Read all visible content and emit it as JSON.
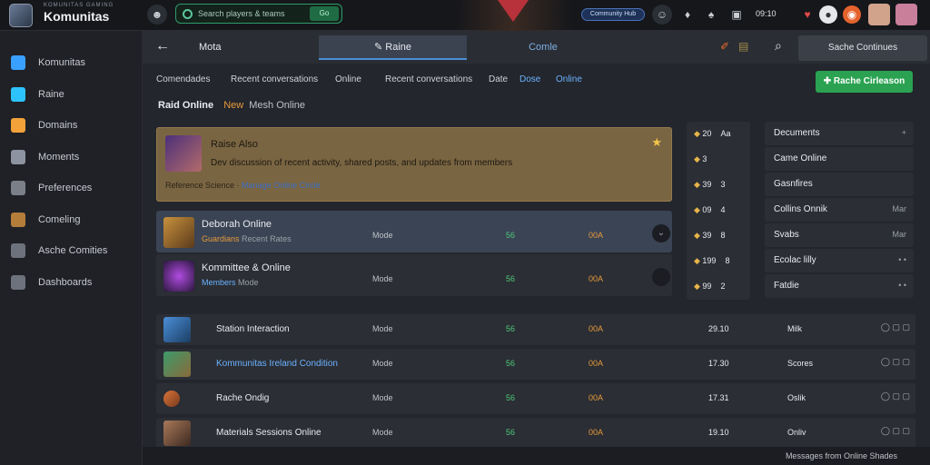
{
  "app": {
    "title": "Komunitas",
    "subtitle": "KOMUNITAS GAMING",
    "search_text": "Search players & teams",
    "search_button": "Go",
    "notice_pill": "Community Hub",
    "clock": "09:10"
  },
  "sidebar": {
    "items": [
      {
        "label": "Komunitas",
        "icon": "globe-icon",
        "color": "#3aa0ff"
      },
      {
        "label": "Raine",
        "icon": "chart-icon",
        "color": "#2ec3ff"
      },
      {
        "label": "Domains",
        "icon": "star-icon",
        "color": "#f3a23a"
      },
      {
        "label": "Moments",
        "icon": "people-icon",
        "color": "#8d93a0"
      },
      {
        "label": "Preferences",
        "icon": "briefcase-icon",
        "color": "#7a7f88"
      },
      {
        "label": "Comeling",
        "icon": "folder-icon",
        "color": "#b57d3a"
      },
      {
        "label": "Asche Comities",
        "icon": "box-icon",
        "color": "#6d727c"
      },
      {
        "label": "Dashboards",
        "icon": "chat-icon",
        "color": "#6d727c"
      }
    ]
  },
  "subheader": {
    "title": "Mota",
    "active_tab": "Raine",
    "second_tab": "Comle",
    "search_label": "Sache Continues"
  },
  "filters": {
    "items": [
      "Comendades",
      "Recent conversations",
      "Online",
      "Recent conversations",
      "Date",
      "Dose",
      "Online"
    ]
  },
  "cta_label": "Rache Cirleason",
  "subtabs": {
    "tab1": "Raid Online",
    "tab2": "Mesh Online",
    "badge": "New"
  },
  "feature": {
    "title": "Raise Also",
    "description": "Dev discussion of recent activity, shared posts, and updates from members",
    "meta": "Reference Science",
    "meta_link": "Manage Online Circle"
  },
  "grid_rows": [
    {
      "name": "Deborah Online",
      "sub": "Guardians",
      "sub2": "Recent Rates",
      "c1": "Mode",
      "c2": "56",
      "c3": "00A"
    },
    {
      "name": "Kommittee & Online",
      "sub": "Members",
      "sub2": "Mode",
      "c1": "Mode",
      "c2": "56",
      "c3": "00A"
    }
  ],
  "list_rows": [
    {
      "name": "Station Interaction",
      "c1": "Mode",
      "c2": "56",
      "c3": "00A",
      "c4": "29.10",
      "c5": "Milk"
    },
    {
      "name": "Kommunitas Ireland Condition",
      "c1": "Mode",
      "c2": "56",
      "c3": "00A",
      "c4": "17.30",
      "c5": "Scores"
    },
    {
      "name": "Rache Ondig",
      "c1": "Mode",
      "c2": "56",
      "c3": "00A",
      "c4": "17.31",
      "c5": "Oslik"
    },
    {
      "name": "Materials Sessions Online",
      "c1": "Mode",
      "c2": "56",
      "c3": "00A",
      "c4": "19.10",
      "c5": "Onliv"
    }
  ],
  "stats": [
    {
      "value": "20",
      "suffix": "Aa"
    },
    {
      "value": "3",
      "suffix": ""
    },
    {
      "value": "39",
      "suffix": "3"
    },
    {
      "value": "09",
      "suffix": "4"
    },
    {
      "value": "39",
      "suffix": "8"
    },
    {
      "value": "199",
      "suffix": "8"
    },
    {
      "value": "99",
      "suffix": "2"
    }
  ],
  "users": [
    {
      "label": "Decuments",
      "right": "+"
    },
    {
      "label": "Came Online",
      "right": ""
    },
    {
      "label": "Gasnfires",
      "right": ""
    },
    {
      "label": "Collins Onnik",
      "right": "Mar"
    },
    {
      "label": "Svabs",
      "right": "Mar"
    },
    {
      "label": "Ecolac lilly",
      "right": "• •"
    },
    {
      "label": "Fatdie",
      "right": "• •"
    }
  ],
  "footer": {
    "text": "Messages from Online Shades"
  }
}
